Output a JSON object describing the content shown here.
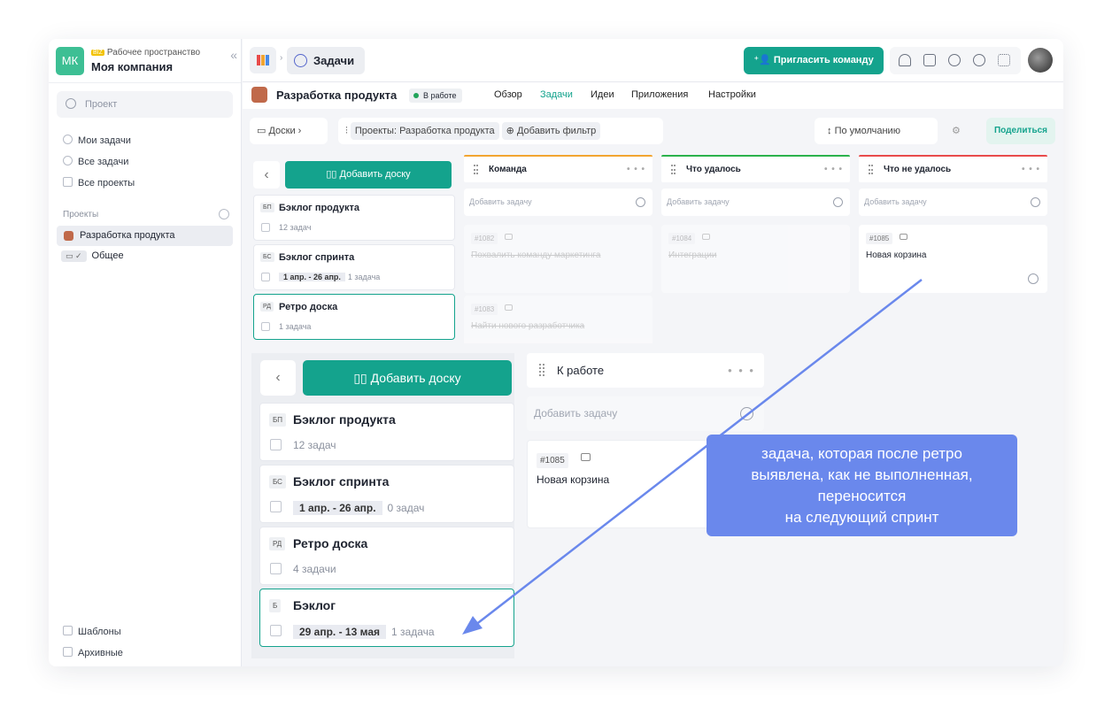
{
  "workspace": {
    "avatar": "МК",
    "badge": "BIZ",
    "label": "Рабочее пространство",
    "name": "Моя компания",
    "collapse_icon": "«"
  },
  "sidebar": {
    "search_placeholder": "Проект",
    "nav": [
      "Мои задачи",
      "Все задачи",
      "Все проекты"
    ],
    "projects_label": "Проекты",
    "active_project": "Разработка продукта",
    "general": "Общее",
    "templates": "Шаблоны",
    "archive": "Архивные"
  },
  "topbar": {
    "tab_label": "Задачи",
    "invite_label": "Пригласить команду"
  },
  "project": {
    "title": "Разработка продукта",
    "status": "В работе",
    "tabs": [
      "Обзор",
      "Задачи",
      "Идеи",
      "Приложения",
      "Настройки"
    ],
    "active_tab_color": "#14a38d"
  },
  "filters": {
    "boards_label": "Доски",
    "projects_prefix": "Проекты:",
    "project_chip": "Разработка продукта",
    "add_filter": "Добавить фильтр",
    "sort": "По умолчанию",
    "share": "Поделиться"
  },
  "boards_small": {
    "add_board": "Добавить доску",
    "items": [
      {
        "abbr": "БП",
        "name": "Бэклог продукта",
        "dates": "",
        "count": "12 задач"
      },
      {
        "abbr": "БС",
        "name": "Бэклог спринта",
        "dates": "1 апр. - 26 апр.",
        "count": "1 задача"
      },
      {
        "abbr": "РД",
        "name": "Ретро доска",
        "dates": "",
        "count": "1 задача"
      }
    ]
  },
  "columns": [
    {
      "title": "Команда",
      "color": "#f2a531",
      "add": "Добавить задачу"
    },
    {
      "title": "Что удалось",
      "color": "#2bb24c",
      "add": "Добавить задачу"
    },
    {
      "title": "Что не удалось",
      "color": "#e84b4b",
      "add": "Добавить задачу"
    }
  ],
  "cards": [
    {
      "num": "#1082",
      "title": "Похвалить команду маркетинга"
    },
    {
      "num": "#1083",
      "title": "Найти нового разработчика"
    },
    {
      "num": "#1084",
      "title": "Интеграции"
    },
    {
      "num": "#1085",
      "title": "Новая корзина"
    }
  ],
  "zoom": {
    "add_board": "Добавить доску",
    "boards": [
      {
        "abbr": "БП",
        "name": "Бэклог продукта",
        "dates": "",
        "count": "12 задач"
      },
      {
        "abbr": "БС",
        "name": "Бэклог спринта",
        "dates": "1 апр. - 26 апр.",
        "count": "0 задач"
      },
      {
        "abbr": "РД",
        "name": "Ретро доска",
        "dates": "",
        "count": "4 задачи"
      },
      {
        "abbr": "Б",
        "name": "Бэклог",
        "dates": "29 апр. - 13 мая",
        "count": "1 задача"
      }
    ],
    "column_title": "К работе",
    "add_task": "Добавить задачу",
    "card_num": "#1085",
    "card_title": "Новая корзина"
  },
  "annotation": {
    "lines": [
      "задача, которая после ретро",
      "выявлена, как не выполненная,",
      "переносится",
      "на следующий спринт"
    ],
    "color": "#6a88ec"
  }
}
